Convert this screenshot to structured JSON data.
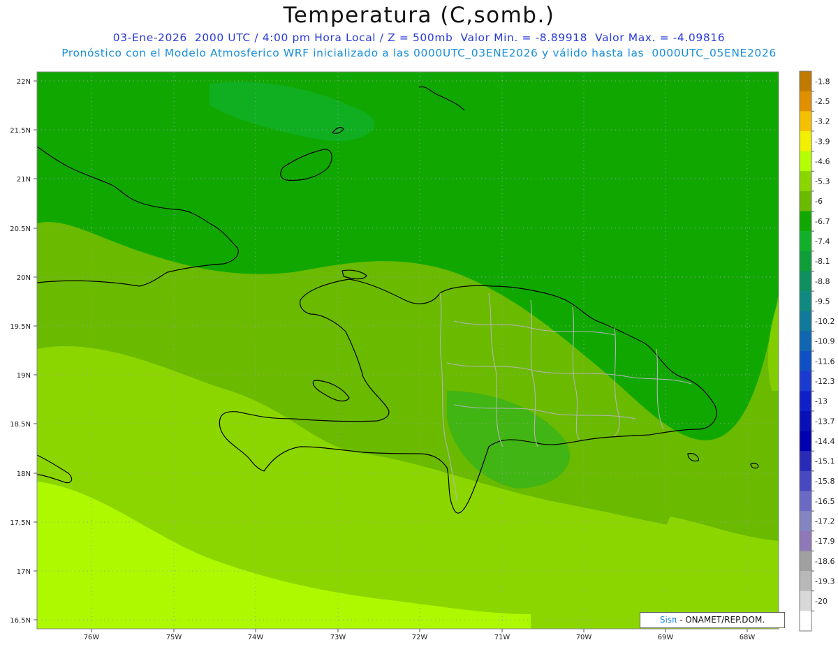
{
  "header": {
    "title": "Temperatura (C,somb.)",
    "line1": "03-Ene-2026  2000 UTC / 4:00 pm Hora Local / Z = 500mb  Valor Min. = -8.89918  Valor Max. = -4.09816",
    "line2": "Pronóstico con el Modelo Atmosferico WRF inicializado a las 0000UTC_03ENE2026 y válido hasta las  0000UTC_05ENE2026"
  },
  "map": {
    "lat_labels": [
      "22N",
      "21.5N",
      "21N",
      "20.5N",
      "20N",
      "19.5N",
      "19N",
      "18.5N",
      "18N",
      "17.5N",
      "17N",
      "16.5N"
    ],
    "lon_labels": [
      "76W",
      "75W",
      "74W",
      "73W",
      "72W",
      "71W",
      "70W",
      "69W",
      "68W"
    ],
    "lat_range": [
      16.5,
      22
    ],
    "lon_range": [
      -76.7,
      -67.6
    ],
    "gridlines": "dotted",
    "outline_color_coast": "#000000",
    "outline_color_provinces": "#b0b0b0"
  },
  "colorbar": {
    "placement": "right",
    "levels": [
      "-1.8",
      "-2.5",
      "-3.2",
      "-3.9",
      "-4.6",
      "-5.3",
      "-6",
      "-6.7",
      "-7.4",
      "-8.1",
      "-8.8",
      "-9.5",
      "-10.2",
      "-10.9",
      "-11.6",
      "-12.3",
      "-13",
      "-13.7",
      "-14.4",
      "-15.1",
      "-15.8",
      "-16.5",
      "-17.2",
      "-17.9",
      "-18.6",
      "-19.3",
      "-20"
    ],
    "colors": [
      "#c07a00",
      "#e09000",
      "#f5c000",
      "#f0f000",
      "#b4ff00",
      "#8cd600",
      "#6aba00",
      "#10a800",
      "#10b02a",
      "#0e9f3a",
      "#0e9060",
      "#108a80",
      "#107a9a",
      "#1066b0",
      "#1050c4",
      "#1a3ad0",
      "#1020c8",
      "#0a10b8",
      "#0000b0",
      "#2a2ab8",
      "#4848c0",
      "#6a6ac4",
      "#8484c0",
      "#8e78b8",
      "#a0a0a0",
      "#b8b8b8",
      "#d8d8d8",
      "#ffffff"
    ]
  },
  "credit": {
    "brand": "Sisπ",
    "text": " - ONAMET/REP.DOM."
  }
}
